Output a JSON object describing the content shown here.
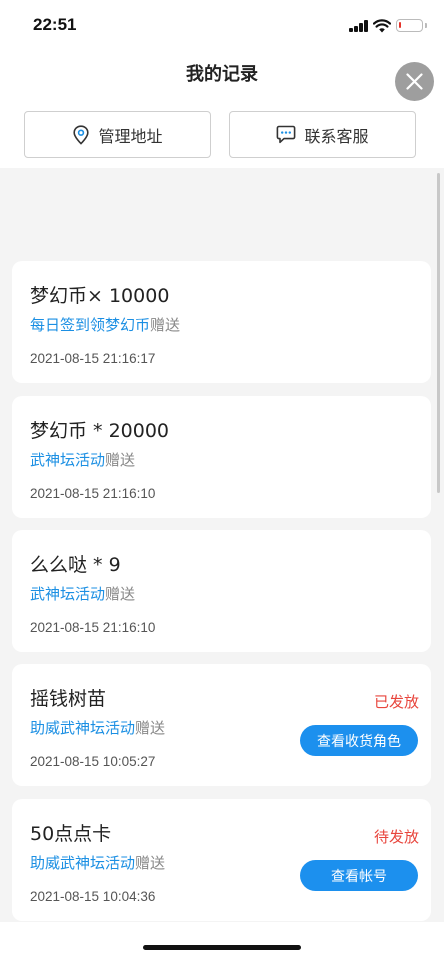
{
  "status_bar": {
    "time": "22:51",
    "battery_level": 0.1,
    "battery_color": "#e5332a"
  },
  "header": {
    "title": "我的记录",
    "close_icon": "close-icon"
  },
  "actions": {
    "address_label": "管理地址",
    "address_icon": "location-pin-icon",
    "service_label": "联系客服",
    "service_icon": "chat-bubble-icon"
  },
  "colors": {
    "accent": "#1b8fe3",
    "button_blue": "#1c90ee",
    "status_red": "#e8453c",
    "list_bg": "#f4f4f4"
  },
  "records": [
    {
      "title": "梦幻币× 10000",
      "source": "每日签到领梦幻币",
      "suffix": "赠送",
      "time": "2021-08-15 21:16:17"
    },
    {
      "title": "梦幻币 * 20000",
      "source": "武神坛活动",
      "suffix": "赠送",
      "time": "2021-08-15 21:16:10"
    },
    {
      "title": "么么哒 * 9",
      "source": "武神坛活动",
      "suffix": "赠送",
      "time": "2021-08-15 21:16:10"
    },
    {
      "title": "摇钱树苗",
      "source": "助威武神坛活动",
      "suffix": "赠送",
      "time": "2021-08-15 10:05:27",
      "status": "已发放",
      "button": "查看收货角色"
    },
    {
      "title": "50点点卡",
      "source": "助威武神坛活动",
      "suffix": "赠送",
      "time": "2021-08-15 10:04:36",
      "status": "待发放",
      "button": "查看帐号"
    }
  ]
}
